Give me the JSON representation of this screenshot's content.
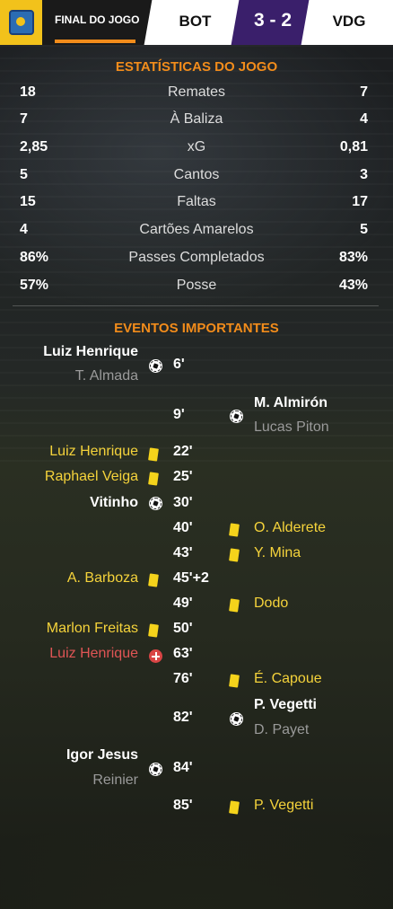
{
  "header": {
    "status": "FINAL DO JOGO",
    "home_team": "BOT",
    "score": "3 - 2",
    "away_team": "VDG",
    "colors": {
      "accent": "#f28c1b",
      "logo_bg": "#f2c21b",
      "score_bg": "#3a1f6b"
    }
  },
  "stats": {
    "title": "ESTATÍSTICAS DO JOGO",
    "rows": [
      {
        "home": "18",
        "label": "Remates",
        "away": "7"
      },
      {
        "home": "7",
        "label": "À Baliza",
        "away": "4"
      },
      {
        "home": "2,85",
        "label": "xG",
        "away": "0,81"
      },
      {
        "home": "5",
        "label": "Cantos",
        "away": "3"
      },
      {
        "home": "15",
        "label": "Faltas",
        "away": "17"
      },
      {
        "home": "4",
        "label": "Cartões Amarelos",
        "away": "5"
      },
      {
        "home": "86%",
        "label": "Passes Completados",
        "away": "83%"
      },
      {
        "home": "57%",
        "label": "Posse",
        "away": "43%"
      }
    ]
  },
  "events": {
    "title": "EVENTOS IMPORTANTES",
    "items": [
      {
        "side": "home",
        "type": "goal",
        "minute": "6'",
        "player": "Luiz Henrique",
        "assist": "T. Almada"
      },
      {
        "side": "away",
        "type": "goal",
        "minute": "9'",
        "player": "M. Almirón",
        "assist": "Lucas Piton"
      },
      {
        "side": "home",
        "type": "yellow",
        "minute": "22'",
        "player": "Luiz Henrique"
      },
      {
        "side": "home",
        "type": "yellow",
        "minute": "25'",
        "player": "Raphael Veiga"
      },
      {
        "side": "home",
        "type": "goal",
        "minute": "30'",
        "player": "Vitinho"
      },
      {
        "side": "away",
        "type": "yellow",
        "minute": "40'",
        "player": "O. Alderete"
      },
      {
        "side": "away",
        "type": "yellow",
        "minute": "43'",
        "player": "Y. Mina"
      },
      {
        "side": "home",
        "type": "yellow",
        "minute": "45'+2",
        "player": "A. Barboza"
      },
      {
        "side": "away",
        "type": "yellow",
        "minute": "49'",
        "player": "Dodo"
      },
      {
        "side": "home",
        "type": "yellow",
        "minute": "50'",
        "player": "Marlon Freitas"
      },
      {
        "side": "home",
        "type": "injury",
        "minute": "63'",
        "player": "Luiz Henrique"
      },
      {
        "side": "away",
        "type": "yellow",
        "minute": "76'",
        "player": "É. Capoue"
      },
      {
        "side": "away",
        "type": "goal",
        "minute": "82'",
        "player": "P. Vegetti",
        "assist": "D. Payet"
      },
      {
        "side": "home",
        "type": "goal",
        "minute": "84'",
        "player": "Igor Jesus",
        "assist": "Reinier"
      },
      {
        "side": "away",
        "type": "yellow",
        "minute": "85'",
        "player": "P. Vegetti"
      }
    ]
  }
}
